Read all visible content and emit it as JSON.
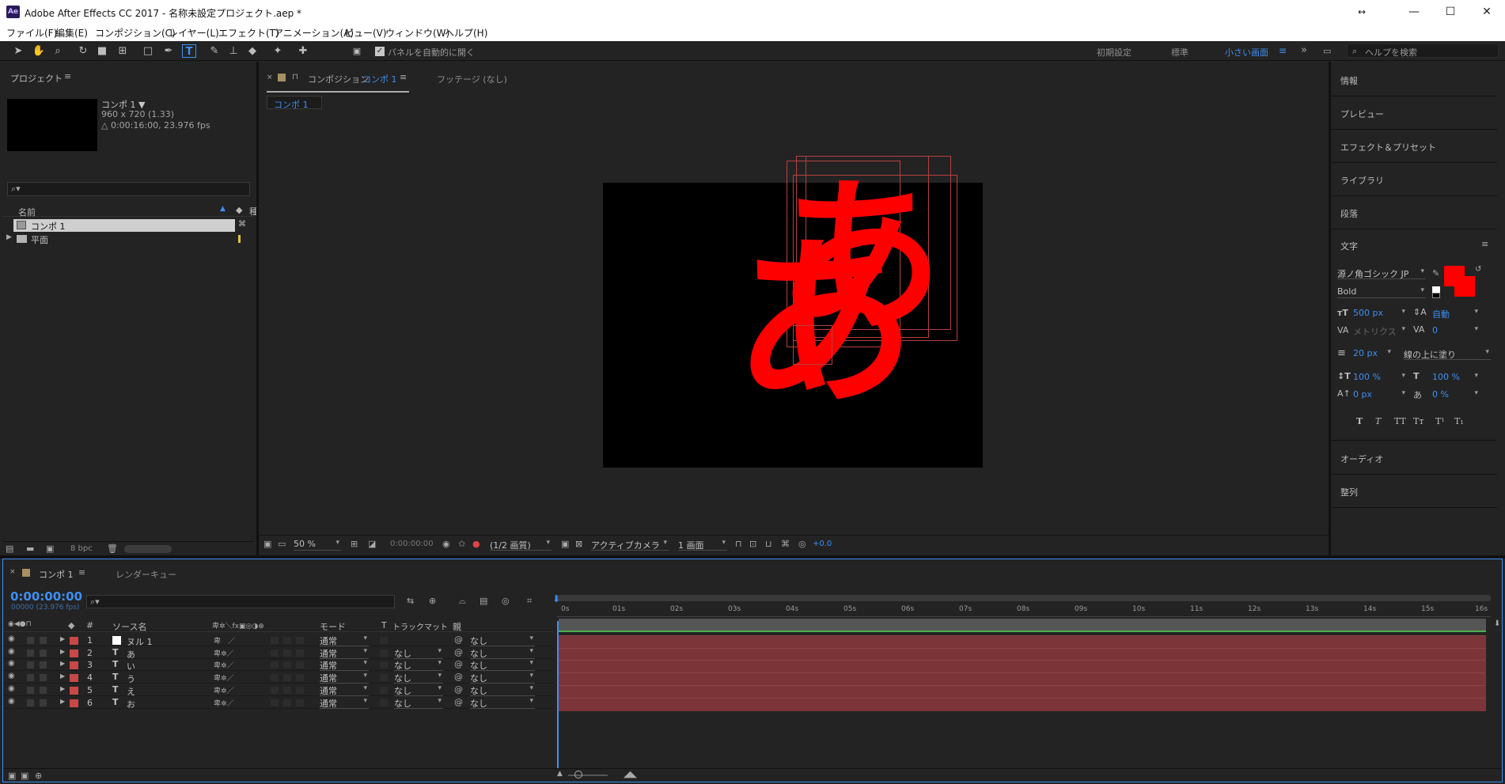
{
  "window": {
    "app_badge": "Ae",
    "title": "Adobe After Effects CC 2017 - 名称未設定プロジェクト.aep *"
  },
  "menu": [
    "ファイル(F)",
    "編集(E)",
    "コンポジション(C)",
    "レイヤー(L)",
    "エフェクト(T)",
    "アニメーション(A)",
    "ビュー(V)",
    "ウィンドウ(W)",
    "ヘルプ(H)"
  ],
  "toolbar": {
    "auto_open_label": "パネルを自動的に開く",
    "workspaces": [
      "初期設定",
      "標準",
      "小さい画面"
    ],
    "search_placeholder": "ヘルプを検索"
  },
  "project": {
    "title": "プロジェクト",
    "comp_name": "コンポ 1 ▼",
    "dims": "960 x 720 (1.33)",
    "duration": "△ 0:00:16:00, 23.976 fps",
    "search_icon": "⌕▾",
    "col_name": "名前",
    "items": [
      {
        "name": "コンポ 1"
      },
      {
        "name": "平面"
      }
    ],
    "bpc": "8 bpc"
  },
  "comp_panel": {
    "tab_label": "コンポジション",
    "tab_comp": "コンポ 1",
    "footage_tab": "フッテージ (なし)",
    "sub_tab": "コンポ 1",
    "text_char": "あ"
  },
  "viewer_bar": {
    "zoom": "50 %",
    "timecode": "0:00:00:00",
    "resolution": "(1/2 画質)",
    "camera": "アクティブカメラ",
    "views": "1 画面",
    "exposure": "+0.0"
  },
  "right_panels": {
    "sections": [
      "情報",
      "プレビュー",
      "エフェクト＆プリセット",
      "ライブラリ",
      "段落"
    ],
    "text_title": "文字",
    "font": "源ノ角ゴシック JP",
    "style": "Bold",
    "size": "500 px",
    "leading": "自動",
    "kerning": "メトリクス",
    "tracking": "0",
    "stroke": "20 px",
    "stroke_mode": "線の上に塗り",
    "vscale": "100 %",
    "hscale": "100 %",
    "baseline": "0 px",
    "tsume": "0 %",
    "styles": [
      "T",
      "T",
      "TT",
      "Tт",
      "T¹",
      "T₁"
    ],
    "audio": "オーディオ",
    "align": "整列",
    "fill_color": "#ff0000"
  },
  "timeline": {
    "tab": "コンポ 1",
    "render_tab": "レンダーキュー",
    "timecode": "0:00:00:00",
    "frames": "00000 (23.976 fps)",
    "search_icon": "⌕▾",
    "headers": {
      "num": "#",
      "source": "ソース名",
      "mode": "モード",
      "trackmatte": "トラックマット",
      "parent": "親"
    },
    "ruler": [
      "0s",
      "01s",
      "02s",
      "03s",
      "04s",
      "05s",
      "06s",
      "07s",
      "08s",
      "09s",
      "10s",
      "11s",
      "12s",
      "13s",
      "14s",
      "15s",
      "16s"
    ],
    "layers": [
      {
        "num": "1",
        "type": "□",
        "name": "ヌル 1",
        "mode": "通常",
        "matte": "",
        "parent": "なし"
      },
      {
        "num": "2",
        "type": "T",
        "name": "あ",
        "mode": "通常",
        "matte": "なし",
        "parent": "なし"
      },
      {
        "num": "3",
        "type": "T",
        "name": "い",
        "mode": "通常",
        "matte": "なし",
        "parent": "なし"
      },
      {
        "num": "4",
        "type": "T",
        "name": "う",
        "mode": "通常",
        "matte": "なし",
        "parent": "なし"
      },
      {
        "num": "5",
        "type": "T",
        "name": "え",
        "mode": "通常",
        "matte": "なし",
        "parent": "なし"
      },
      {
        "num": "6",
        "type": "T",
        "name": "お",
        "mode": "通常",
        "matte": "なし",
        "parent": "なし"
      }
    ]
  }
}
